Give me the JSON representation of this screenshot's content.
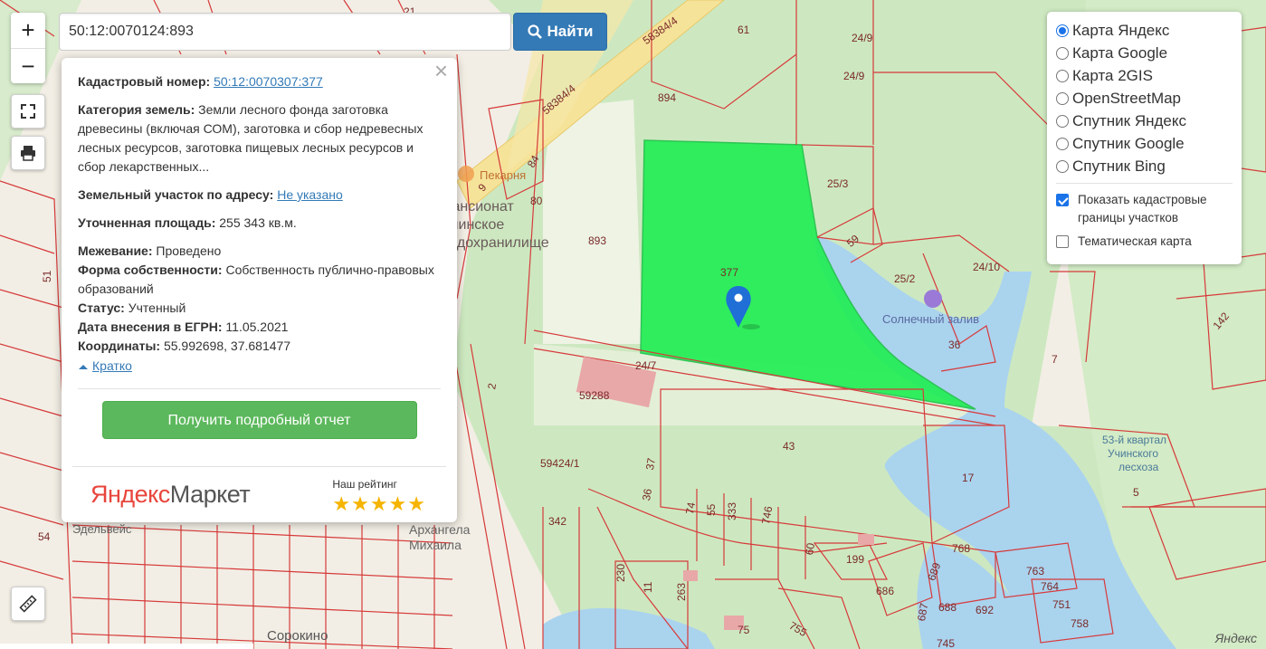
{
  "search": {
    "value": "50:12:0070124:893",
    "button_label": "Найти"
  },
  "controls": {
    "zoom_in": "+",
    "zoom_out": "−"
  },
  "popup": {
    "cadastral_label": "Кадастровый номер:",
    "cadastral_value": "50:12:0070307:377",
    "category_label": "Категория земель:",
    "category_value": "Земли лесного фонда заготовка древесины (включая СОМ), заготовка и сбор недревесных лесных ресурсов, заготовка пищевых лесных ресурсов и сбор лекарственных...",
    "address_label": "Земельный участок по адресу:",
    "address_value": "Не указано",
    "area_label": "Уточненная площадь:",
    "area_value": "255 343 кв.м.",
    "survey_label": "Межевание:",
    "survey_value": "Проведено",
    "ownership_label": "Форма собственности:",
    "ownership_value": "Собственность публично-правовых образований",
    "status_label": "Статус:",
    "status_value": "Учтенный",
    "egrn_label": "Дата внесения в ЕГРН:",
    "egrn_value": "11.05.2021",
    "coords_label": "Координаты:",
    "coords_value": "55.992698, 37.681477",
    "collapse_label": "Кратко",
    "report_button": "Получить подробный отчет",
    "market_logo_ya": "Яндекс",
    "market_logo_rest": "Маркет",
    "rating_label": "Наш рейтинг",
    "rating_stars": "★★★★★",
    "close_glyph": "×"
  },
  "layers": {
    "options": [
      "Карта Яндекс",
      "Карта Google",
      "Карта 2GIS",
      "OpenStreetMap",
      "Спутник Яндекс",
      "Спутник Google",
      "Спутник Bing"
    ],
    "selected": "Карта Яндекс",
    "show_borders_label": "Показать кадастровые границы участков",
    "show_borders_checked": true,
    "thematic_label": "Тематическая карта",
    "thematic_checked": false
  },
  "map": {
    "highlight_color": "#22ee55",
    "parcel_outline_color": "#d63a3a",
    "water_color": "#aad3ee",
    "selected_parcel_label": "377",
    "parcel_labels": [
      "894",
      "61",
      "24/9",
      "24/9",
      "25/3",
      "59",
      "25/2",
      "24/10",
      "893",
      "84",
      "80",
      "9",
      "36",
      "7",
      "142",
      "24/7",
      "59288",
      "43",
      "17",
      "5",
      "59424/1",
      "37",
      "36",
      "342",
      "74",
      "55",
      "333",
      "746",
      "60",
      "199",
      "768",
      "763",
      "764",
      "751",
      "758",
      "686",
      "689",
      "688",
      "692",
      "687",
      "745",
      "230",
      "11",
      "263",
      "75",
      "755",
      "54",
      "51",
      "58384/4",
      "58384/4",
      "21",
      "2"
    ],
    "poi_labels": [
      "Пекарня",
      "Солнечный залив",
      "Пансионат Учинское водохранилище",
      "53-й квартал Учинского лесхоза",
      "Сорокино",
      "Архангела Михаила",
      "Эдельвейс"
    ]
  },
  "watermark": "Яндекс"
}
